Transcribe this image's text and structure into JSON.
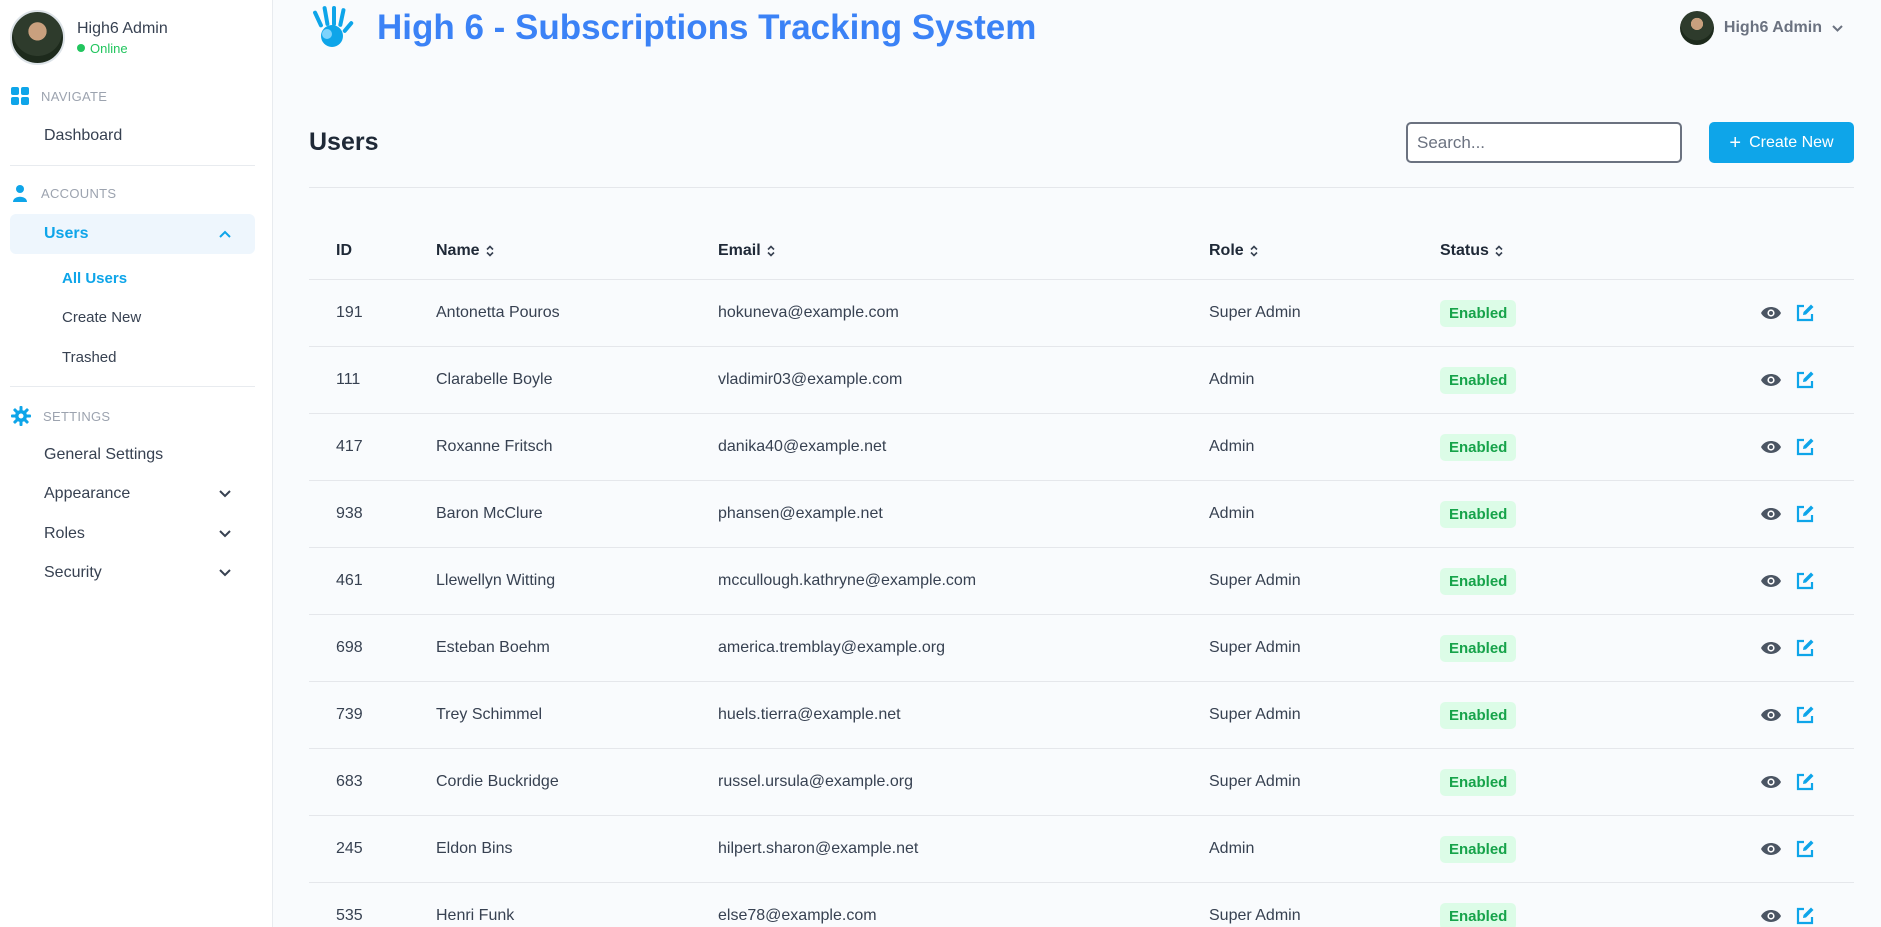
{
  "profile": {
    "name": "High6 Admin",
    "status": "Online"
  },
  "sidebar": {
    "navigate_label": "NAVIGATE",
    "dashboard": "Dashboard",
    "accounts_label": "ACCOUNTS",
    "users": "Users",
    "users_sub": [
      "All Users",
      "Create New",
      "Trashed"
    ],
    "settings_label": "SETTINGS",
    "general_settings": "General Settings",
    "appearance": "Appearance",
    "roles": "Roles",
    "security": "Security"
  },
  "header": {
    "title": "High 6 - Subscriptions Tracking System",
    "user_name": "High6 Admin"
  },
  "page": {
    "title": "Users",
    "search_placeholder": "Search...",
    "create_label": "Create New"
  },
  "table": {
    "headers": {
      "id": "ID",
      "name": "Name",
      "email": "Email",
      "role": "Role",
      "status": "Status"
    },
    "rows": [
      {
        "id": "191",
        "name": "Antonetta Pouros",
        "email": "hokuneva@example.com",
        "role": "Super Admin",
        "status": "Enabled"
      },
      {
        "id": "111",
        "name": "Clarabelle Boyle",
        "email": "vladimir03@example.com",
        "role": "Admin",
        "status": "Enabled"
      },
      {
        "id": "417",
        "name": "Roxanne Fritsch",
        "email": "danika40@example.net",
        "role": "Admin",
        "status": "Enabled"
      },
      {
        "id": "938",
        "name": "Baron McClure",
        "email": "phansen@example.net",
        "role": "Admin",
        "status": "Enabled"
      },
      {
        "id": "461",
        "name": "Llewellyn Witting",
        "email": "mccullough.kathryne@example.com",
        "role": "Super Admin",
        "status": "Enabled"
      },
      {
        "id": "698",
        "name": "Esteban Boehm",
        "email": "america.tremblay@example.org",
        "role": "Super Admin",
        "status": "Enabled"
      },
      {
        "id": "739",
        "name": "Trey Schimmel",
        "email": "huels.tierra@example.net",
        "role": "Super Admin",
        "status": "Enabled"
      },
      {
        "id": "683",
        "name": "Cordie Buckridge",
        "email": "russel.ursula@example.org",
        "role": "Super Admin",
        "status": "Enabled"
      },
      {
        "id": "245",
        "name": "Eldon Bins",
        "email": "hilpert.sharon@example.net",
        "role": "Admin",
        "status": "Enabled"
      },
      {
        "id": "535",
        "name": "Henri Funk",
        "email": "else78@example.com",
        "role": "Super Admin",
        "status": "Enabled"
      }
    ]
  },
  "colors": {
    "accent": "#0ea5e9",
    "title": "#3b82f6",
    "enabled_bg": "#dcfce7",
    "enabled_text": "#16a34a"
  },
  "icons": {
    "view": "eye-icon",
    "edit": "edit-icon",
    "sort": "sort-icon"
  }
}
